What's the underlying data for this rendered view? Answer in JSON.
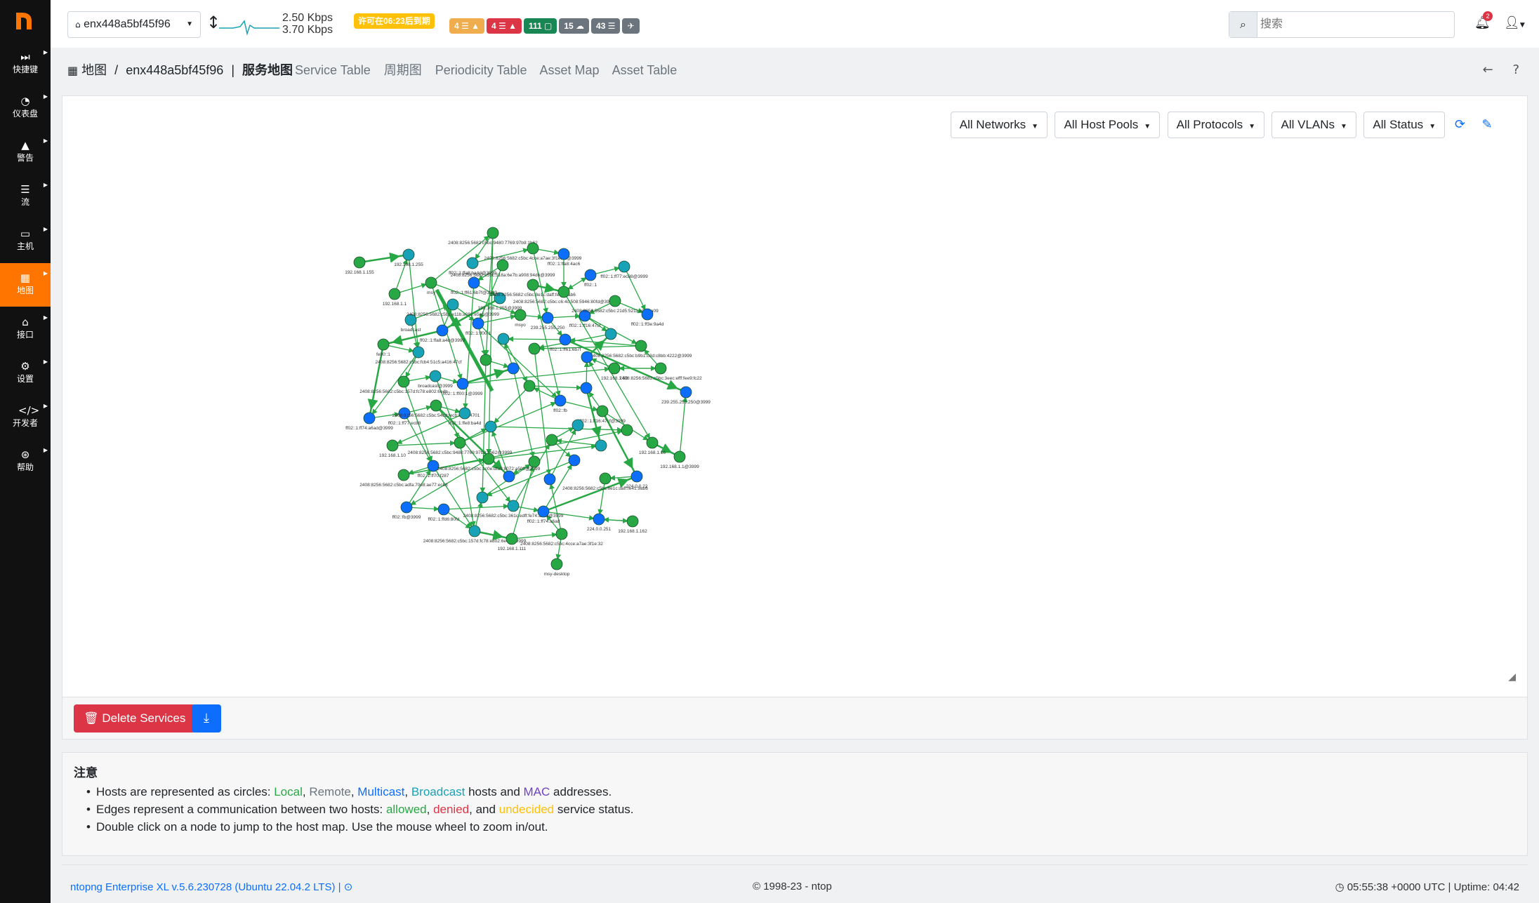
{
  "sidebar": {
    "items": [
      {
        "label": "快捷键",
        "icon": "fast-forward-icon"
      },
      {
        "label": "仪表盘",
        "icon": "gauge-icon"
      },
      {
        "label": "警告",
        "icon": "warning-icon"
      },
      {
        "label": "流",
        "icon": "list-icon"
      },
      {
        "label": "主机",
        "icon": "laptop-icon"
      },
      {
        "label": "地图",
        "icon": "map-icon",
        "active": true
      },
      {
        "label": "接口",
        "icon": "ethernet-icon"
      },
      {
        "label": "设置",
        "icon": "gear-icon"
      },
      {
        "label": "开发者",
        "icon": "code-icon"
      },
      {
        "label": "帮助",
        "icon": "lifebuoy-icon"
      }
    ]
  },
  "topbar": {
    "interface": "enx448a5bf45f96",
    "rate_up": "2.50 Kbps",
    "rate_down": "3.70 Kbps",
    "license_badge": "许可在06:23后到期",
    "badges": [
      {
        "text": "4 ☰ ▲",
        "type": "warn"
      },
      {
        "text": "4 ☰ ▲",
        "type": "err"
      },
      {
        "text": "111 ▢",
        "type": "ok"
      },
      {
        "text": "15 ☁",
        "type": "gray"
      },
      {
        "text": "43 ☰",
        "type": "gray"
      },
      {
        "text": "✈",
        "type": "gray"
      }
    ],
    "search_placeholder": "搜索",
    "notification_count": "2"
  },
  "breadcrumb": {
    "root": "地图",
    "interface": "enx448a5bf45f96",
    "current": "服务地图"
  },
  "tabs": [
    "Service Table",
    "周期图",
    "Periodicity Table",
    "Asset Map",
    "Asset Table"
  ],
  "filters": [
    "All Networks",
    "All Host Pools",
    "All Protocols",
    "All VLANs",
    "All Status"
  ],
  "buttons": {
    "delete": "Delete Services"
  },
  "notes": {
    "title": "注意",
    "line1_prefix": "Hosts are represented as circles: ",
    "local": "Local",
    "remote": "Remote",
    "multicast": "Multicast",
    "broadcast": "Broadcast",
    "line1_mid": " hosts and ",
    "mac": "MAC",
    "line1_suffix": " addresses.",
    "line2_prefix": "Edges represent a communication between two hosts: ",
    "allowed": "allowed",
    "denied": "denied",
    "undecided": "undecided",
    "line2_suffix": " service status.",
    "line3": "Double click on a node to jump to the host map. Use the mouse wheel to zoom in/out."
  },
  "footer": {
    "version": "ntopng Enterprise XL v.5.6.230728 (Ubuntu 22.04.2 LTS) |",
    "copyright": "© 1998-23 - ntop",
    "uptime": "05:55:38 +0000 UTC | Uptime: 04:42"
  },
  "colors": {
    "local": "#28a745",
    "multicast": "#0d6efd",
    "broadcast": "#17a2b8",
    "edge": "#28a745",
    "accent": "#ff7500"
  },
  "graph": {
    "nodes": [
      {
        "label": "192.168.1.155",
        "t": "l"
      },
      {
        "label": "192.168.1.255",
        "t": "b"
      },
      {
        "label": "192.168.1.1",
        "t": "l"
      },
      {
        "label": "msy",
        "t": "l"
      },
      {
        "label": "2408:8256:5682:c5bc:9480:7769:97b9:1b62",
        "t": "l"
      },
      {
        "label": "ff02::1:ffa8:ba4d@3999",
        "t": "b"
      },
      {
        "label": "2408:8256:5682:c5bc:4cce:a7ae:3f1e:32@3999",
        "t": "l"
      },
      {
        "label": "ff02::1:ffa8:4ac6",
        "t": "m"
      },
      {
        "label": "ff02::1",
        "t": "m"
      },
      {
        "label": "ff02::1:ff77:ec88@3999",
        "t": "b"
      },
      {
        "label": "2408:8256:5682:c5bc:518a:6e7b:a908:94d6@3999",
        "t": "l"
      },
      {
        "label": "ff02::1:ff61:6b7f@3999",
        "t": "m"
      },
      {
        "label": "192.168.1.255@3999",
        "t": "b"
      },
      {
        "label": "2408:8256:5682:c5bc:8e1c:daff:fe41:9ab6",
        "t": "l"
      },
      {
        "label": "2408:8256:5682:c5bc:c6:4c:508:5946:80fd@3999",
        "t": "l"
      },
      {
        "label": "broadcast",
        "t": "b"
      },
      {
        "label": "2408:8256:5682:c5bc:e11b:a081:e5a8@3999",
        "t": "b"
      },
      {
        "label": "ff02::1:ff00:1",
        "t": "m"
      },
      {
        "label": "msyo",
        "t": "l"
      },
      {
        "label": "239.255.255.250",
        "t": "m"
      },
      {
        "label": "ff02::1:ff16:47cf",
        "t": "m"
      },
      {
        "label": "2408:8256:5682:c5bc:21d5:5211:e07a:a09",
        "t": "l"
      },
      {
        "label": "ff02::1:ff3e:9a4d",
        "t": "m"
      },
      {
        "label": "ff02::1:ffa8:a4d@3999",
        "t": "m"
      },
      {
        "label": "fe80::1",
        "t": "l"
      },
      {
        "label": "2408:8256:5682:c5bc:fcb4:51c5:a416:47cf",
        "t": "b"
      },
      {
        "label": "2408:8256:5682:c5bc:157d:fc78:e802:6e4b",
        "t": "l"
      },
      {
        "label": "broadcast@3999",
        "t": "b"
      },
      {
        "label": "ff02::1:ff00:1@3999",
        "t": "m"
      },
      {
        "label": "192.168.1.50",
        "t": "l"
      },
      {
        "label": "2408:8256:5682:c5bc:3eec:efff:fee9:fc22",
        "t": "l"
      },
      {
        "label": "2408:8256:5682:c5bc:b9b1:b3d:c8bb:4222@3999",
        "t": "l"
      },
      {
        "label": "ff02::1:ff61:6b7f",
        "t": "m"
      },
      {
        "label": "239.255.255.250@3999",
        "t": "m"
      },
      {
        "label": "ff02::1:ff74:a6ad@3999",
        "t": "m"
      },
      {
        "label": "ff02::1:ff77:ec88",
        "t": "m"
      },
      {
        "label": "2408:8256:5682:c5bc:54cd:fecb:8c45:4701",
        "t": "l"
      },
      {
        "label": "ff02::1:ffe8:ba4d",
        "t": "b"
      },
      {
        "label": "192.168.1.10",
        "t": "l"
      },
      {
        "label": "2408:8256:5682:c5bc:9480:7769:97b9:1b62@3999",
        "t": "l"
      },
      {
        "label": "ff02::fb",
        "t": "m"
      },
      {
        "label": "ff02::1:ff16:47cf@3999",
        "t": "l"
      },
      {
        "label": "192.168.1.16",
        "t": "l"
      },
      {
        "label": "192.168.1.1@3999",
        "t": "l"
      },
      {
        "label": "ff02::1:ff70:f287",
        "t": "m"
      },
      {
        "label": "2408:8256:5682:c5bc:adfa:70e8:ae77:ec88",
        "t": "l"
      },
      {
        "label": "2408:8256:5682:c5bc:1c0e:dfa9:8072:a509@3999",
        "t": "l"
      },
      {
        "label": "ff02::fb@3999",
        "t": "m"
      },
      {
        "label": "ff02::1:ffd6:80fd",
        "t": "m"
      },
      {
        "label": "2408:8256:5682:c5bc:361c:edff:fe74:a6ad@3999",
        "t": "b"
      },
      {
        "label": "ff02::1:ff74:a6ad",
        "t": "m"
      },
      {
        "label": "224.0.0.251",
        "t": "m"
      },
      {
        "label": "192.168.1.162",
        "t": "l"
      },
      {
        "label": "2408:8256:5682:c5bc:157d:fc78:e802:6e4b@3999",
        "t": "b"
      },
      {
        "label": "192.168.1.111",
        "t": "l"
      },
      {
        "label": "2408:8256:5682:c5bc:4cce:a7ae:3f1e:32",
        "t": "l"
      },
      {
        "label": "msy-desktop",
        "t": "l"
      },
      {
        "label": "224.0.0.22",
        "t": "m"
      },
      {
        "label": "2408:8256:5682:c5bc:8e1c:daff:fe41:9ab6",
        "t": "l"
      }
    ]
  }
}
